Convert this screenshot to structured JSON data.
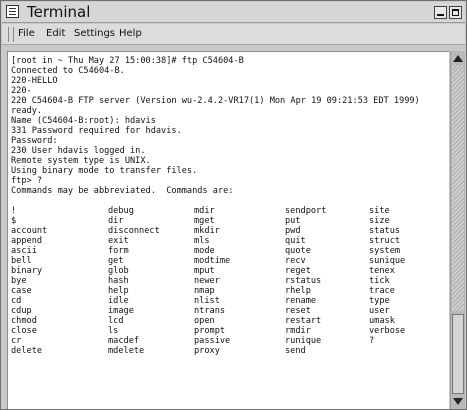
{
  "window": {
    "title": "Terminal"
  },
  "menu": {
    "items": [
      "File",
      "Edit",
      "Settings",
      "Help"
    ]
  },
  "terminal": {
    "lines": [
      "[root in ~ Thu May 27 15:00:38]# ftp C54604-B",
      "Connected to C54604-B.",
      "220-HELLO",
      "220-",
      "220 C54604-B FTP server (Version wu-2.4.2-VR17(1) Mon Apr 19 09:21:53 EDT 1999)",
      "ready.",
      "Name (C54604-B:root): hdavis",
      "331 Password required for hdavis.",
      "Password:",
      "230 User hdavis logged in.",
      "Remote system type is UNIX.",
      "Using binary mode to transfer files.",
      "ftp> ?",
      "Commands may be abbreviated.  Commands are:"
    ],
    "commands": [
      [
        "!",
        "debug",
        "mdir",
        "sendport",
        "site"
      ],
      [
        "$",
        "dir",
        "mget",
        "put",
        "size"
      ],
      [
        "account",
        "disconnect",
        "mkdir",
        "pwd",
        "status"
      ],
      [
        "append",
        "exit",
        "mls",
        "quit",
        "struct"
      ],
      [
        "ascii",
        "form",
        "mode",
        "quote",
        "system"
      ],
      [
        "bell",
        "get",
        "modtime",
        "recv",
        "sunique"
      ],
      [
        "binary",
        "glob",
        "mput",
        "reget",
        "tenex"
      ],
      [
        "bye",
        "hash",
        "newer",
        "rstatus",
        "tick"
      ],
      [
        "case",
        "help",
        "nmap",
        "rhelp",
        "trace"
      ],
      [
        "cd",
        "idle",
        "nlist",
        "rename",
        "type"
      ],
      [
        "cdup",
        "image",
        "ntrans",
        "reset",
        "user"
      ],
      [
        "chmod",
        "lcd",
        "open",
        "restart",
        "umask"
      ],
      [
        "close",
        "ls",
        "prompt",
        "rmdir",
        "verbose"
      ],
      [
        "cr",
        "macdef",
        "passive",
        "runique",
        "?"
      ],
      [
        "delete",
        "mdelete",
        "proxy",
        "send",
        ""
      ]
    ]
  }
}
